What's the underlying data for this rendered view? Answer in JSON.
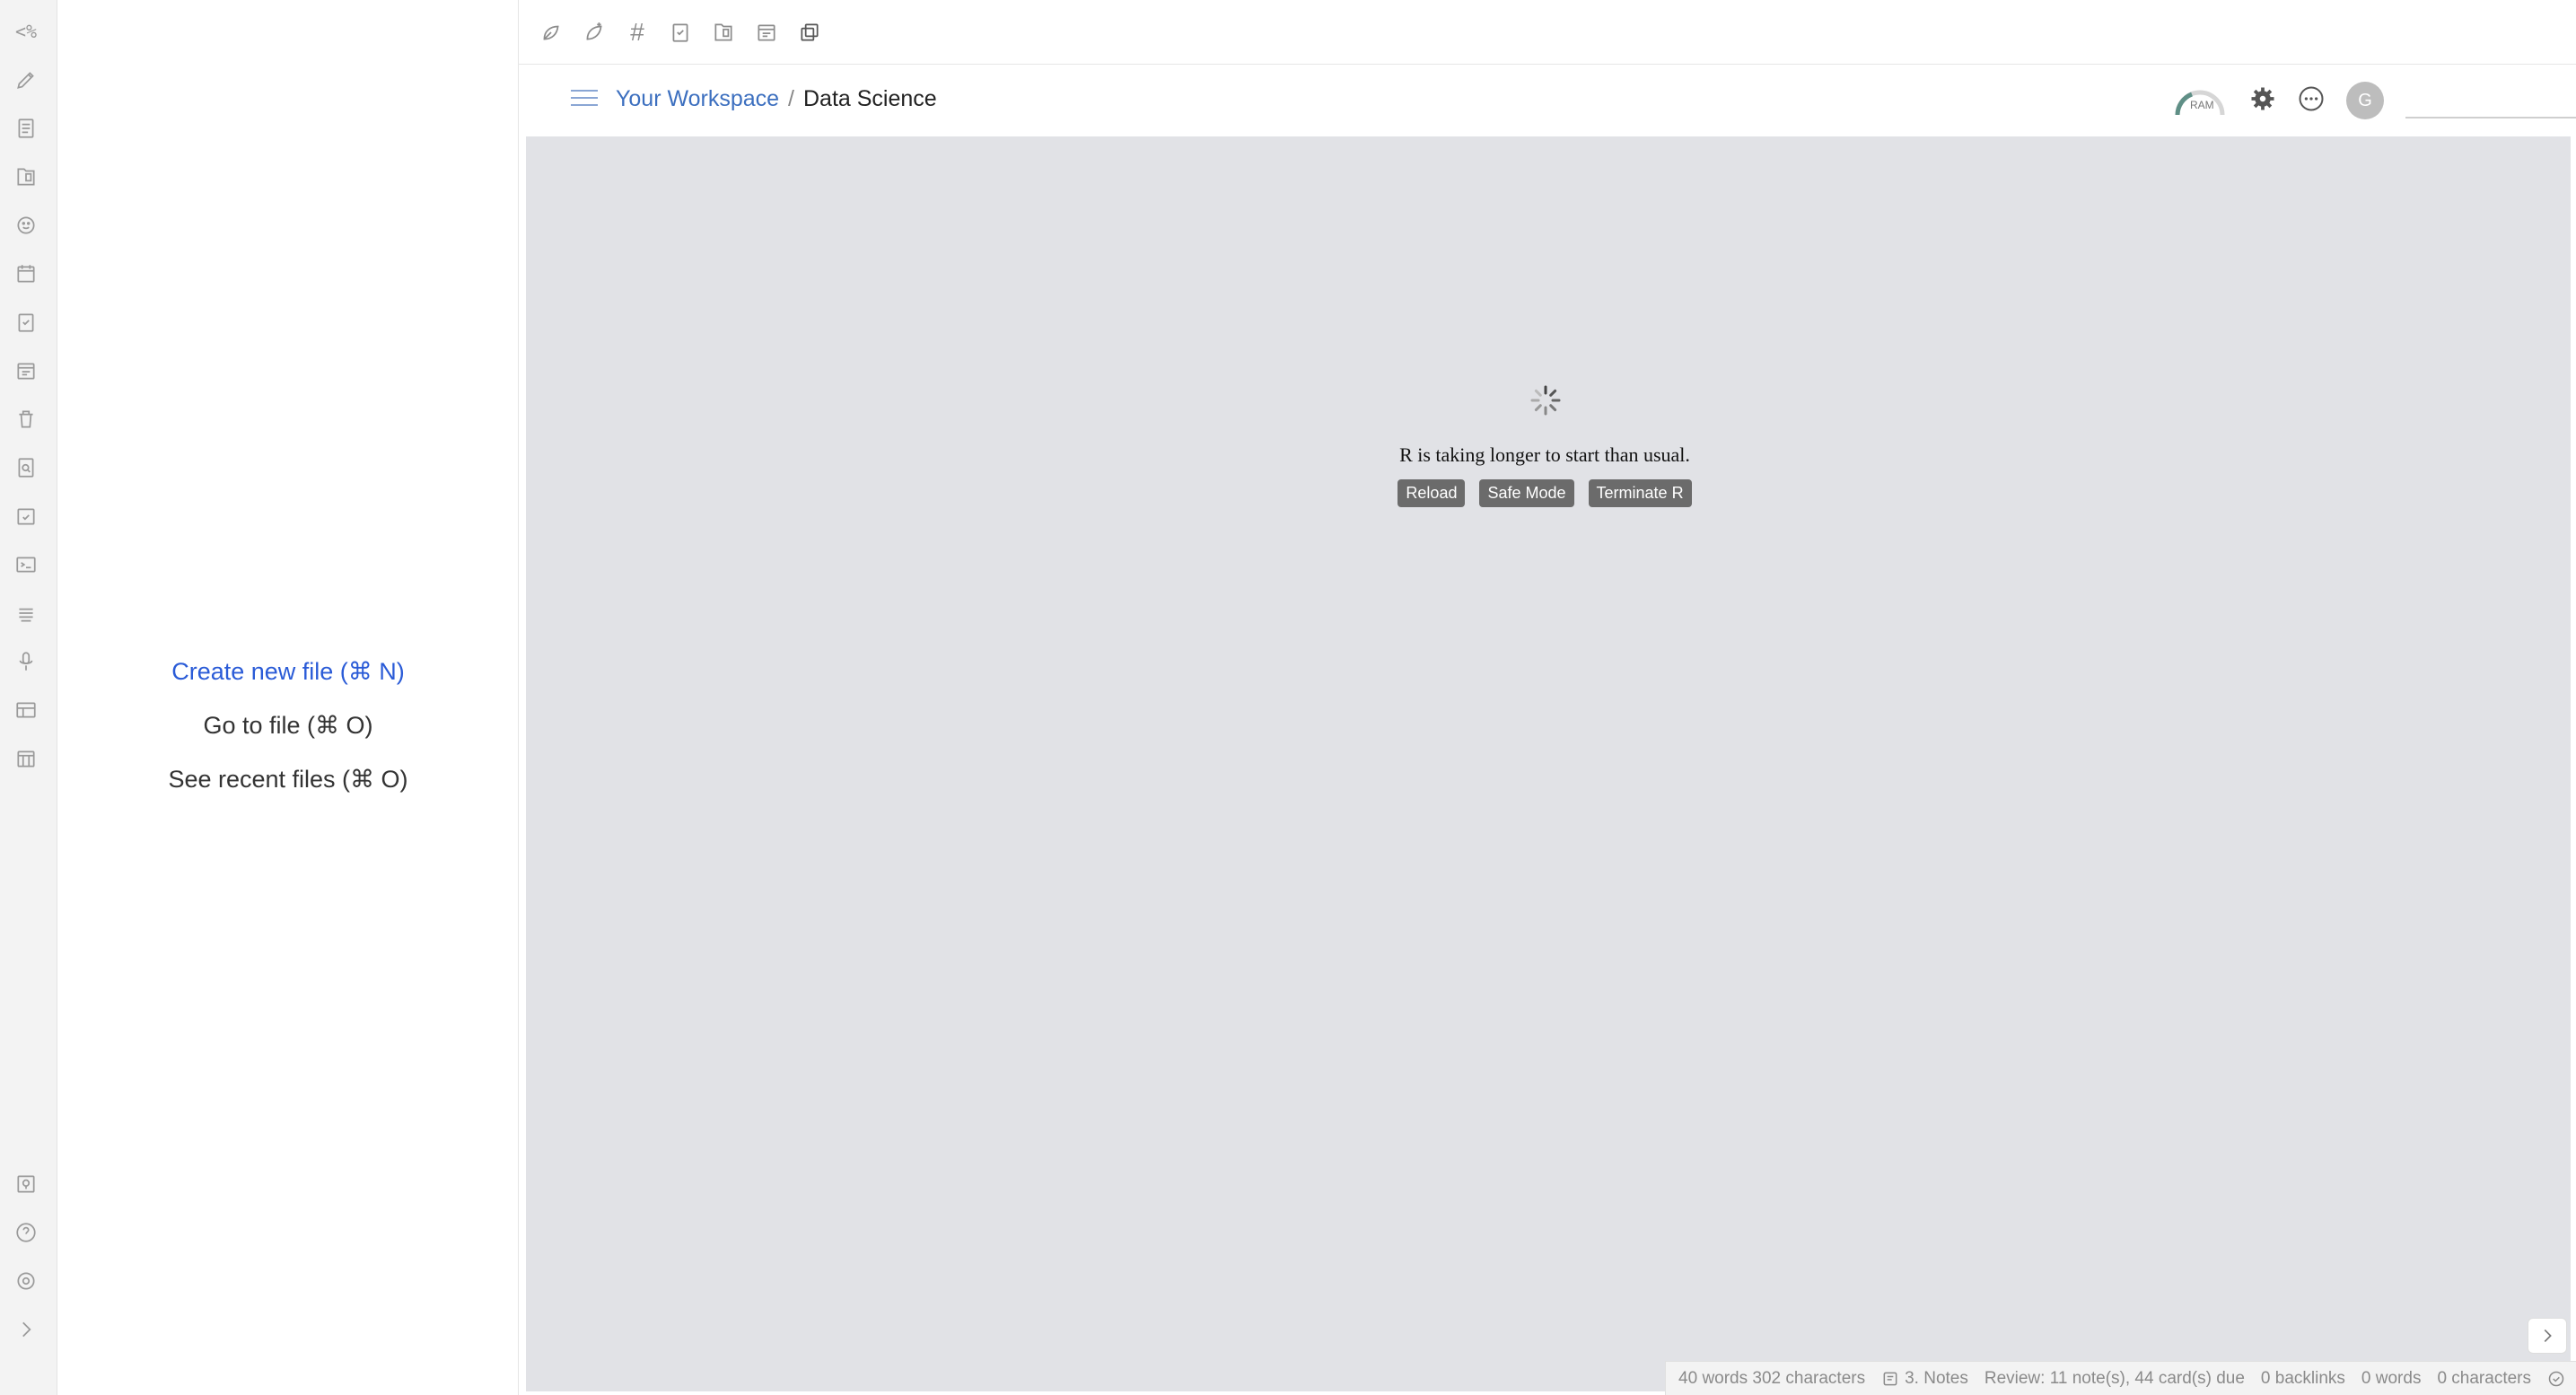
{
  "ribbon": {
    "code_glyph": "<%",
    "top_icons": [
      "pencil-icon",
      "file-text-icon",
      "book-icon",
      "emoji-icon",
      "calendar-icon",
      "checklist-icon",
      "calendar-edit-icon",
      "trash-icon",
      "file-search-icon",
      "calendar-check-icon",
      "terminal-icon",
      "stack-icon",
      "microphone-icon",
      "layout-icon",
      "calendar-grid-icon"
    ],
    "bottom_icons": [
      "vault-icon",
      "help-icon",
      "settings-icon",
      "chevron-right-icon"
    ]
  },
  "sidebar": {
    "create_new": "Create new file (⌘ N)",
    "go_to": "Go to file (⌘ O)",
    "recent": "See recent files (⌘ O)"
  },
  "toolbar": {
    "hash": "#"
  },
  "header": {
    "workspace": "Your Workspace",
    "separator": "/",
    "current": "Data Science",
    "ram_label": "RAM",
    "avatar_initial": "G",
    "search_value": ""
  },
  "loading": {
    "message": "R is taking longer to start than usual.",
    "reload": "Reload",
    "safe_mode": "Safe Mode",
    "terminate": "Terminate R"
  },
  "status": {
    "words_chars": "40 words 302 characters",
    "notes": "3. Notes",
    "review": "Review: 11 note(s), 44 card(s) due",
    "backlinks": "0 backlinks",
    "words": "0 words",
    "characters": "0 characters"
  },
  "colors": {
    "accent": "#3c6fbf",
    "content_bg": "#e1e2e6"
  }
}
